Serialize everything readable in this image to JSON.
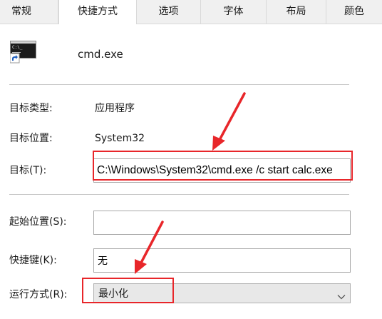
{
  "tabs": [
    {
      "label": "常规"
    },
    {
      "label": "快捷方式"
    },
    {
      "label": "选项"
    },
    {
      "label": "字体"
    },
    {
      "label": "布局"
    },
    {
      "label": "颜色"
    }
  ],
  "active_tab_index": 1,
  "header": {
    "icon_name": "console-shortcut-icon",
    "file_name": "cmd.exe"
  },
  "fields": {
    "target_type_label": "目标类型:",
    "target_type_value": "应用程序",
    "target_location_label": "目标位置:",
    "target_location_value": "System32",
    "target_label": "目标(T):",
    "target_value": "C:\\Windows\\System32\\cmd.exe /c start calc.exe",
    "start_in_label": "起始位置(S):",
    "start_in_value": "",
    "hotkey_label": "快捷键(K):",
    "hotkey_value": "无",
    "run_label": "运行方式(R):",
    "run_value": "最小化"
  },
  "colors": {
    "annotation_red": "#e8262a",
    "tab_bar": "#f0f0f0",
    "select_bg": "#e8e8e8"
  }
}
